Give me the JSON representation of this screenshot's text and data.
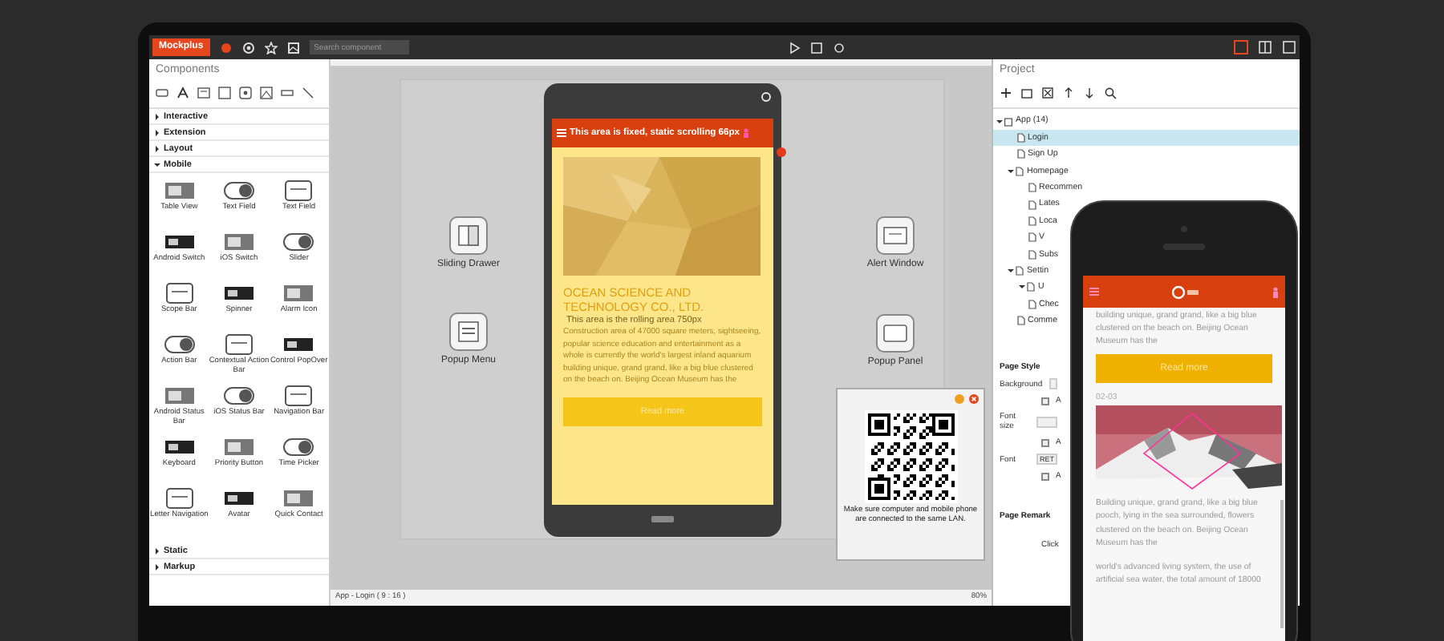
{
  "app": {
    "name": "Mockplus",
    "search": {
      "placeholder": "Search component"
    }
  },
  "components": {
    "title": "Components",
    "categories": [
      {
        "label": "Interactive",
        "expanded": false
      },
      {
        "label": "Extension",
        "expanded": false
      },
      {
        "label": "Layout",
        "expanded": false
      },
      {
        "label": "Mobile",
        "expanded": true
      }
    ],
    "items": [
      "Table View",
      "Text Field",
      "Text Field",
      "Android Switch",
      "iOS Switch",
      "Slider",
      "Scope Bar",
      "Spinner",
      "Alarm Icon",
      "Action Bar",
      "Contextual Action Bar",
      "Control PopOver",
      "Android Status Bar",
      "iOS Status Bar",
      "Navigation Bar",
      "Keyboard",
      "Priority Button",
      "Time Picker",
      "Letter Navigation",
      "Avatar",
      "Quick Contact"
    ],
    "more_categories": [
      {
        "label": "Static",
        "expanded": false
      },
      {
        "label": "Markup",
        "expanded": false
      }
    ]
  },
  "canvas": {
    "left_widgets": [
      "Sliding Drawer",
      "Popup Menu"
    ],
    "right_widgets": [
      "Alert Window",
      "Popup Panel"
    ],
    "device": {
      "header": "This area is fixed, static scrolling 66px",
      "title": "OCEAN SCIENCE AND TECHNOLOGY CO., LTD.",
      "note": "This area is the rolling area 750px",
      "body": "Construction area of 47000 square meters, sightseeing, popular science education and entertainment as a whole is currently the world's largest inland aquarium building unique, grand grand, like a big blue clustered on the beach on. Beijing Ocean Museum has the",
      "button": "Read more"
    },
    "qr_popup": {
      "message": "Make sure computer and mobile phone are connected to the same LAN."
    },
    "status": "App - Login ( 9 : 16 )",
    "zoom": "80%"
  },
  "project": {
    "title": "Project",
    "tree": [
      {
        "label": "App (14)",
        "selected": false,
        "expanded": true,
        "children": [
          {
            "label": "Login",
            "selected": true
          },
          {
            "label": "Sign Up",
            "selected": false
          },
          {
            "label": "Homepage",
            "selected": false,
            "expanded": true,
            "children": [
              {
                "label": "Recommen",
                "selected": false
              },
              {
                "label": "Lates",
                "selected": false
              },
              {
                "label": "Loca",
                "selected": false
              },
              {
                "label": "V",
                "selected": false
              },
              {
                "label": "Subs",
                "selected": false
              }
            ]
          },
          {
            "label": "Settin",
            "selected": false,
            "expanded": true,
            "children": [
              {
                "label": "U",
                "selected": false,
                "expanded": true
              },
              {
                "label": "Chec",
                "selected": false
              }
            ]
          },
          {
            "label": "Comme",
            "selected": false
          }
        ]
      }
    ],
    "page_style": {
      "title": "Page Style",
      "rows": [
        {
          "label": "Background",
          "check": "A",
          "checked": false
        },
        {
          "label": "Font size",
          "check": "A",
          "checked": false
        },
        {
          "label": "Font",
          "value": "RET",
          "check": "A",
          "checked": false
        }
      ]
    },
    "remark": {
      "title": "Page Remark",
      "hint": "Click"
    }
  },
  "phone": {
    "intro": "building unique, grand grand, like a big blue clustered on the beach on. Beijing Ocean Museum has the",
    "button": "Read more",
    "date": "02-03",
    "body": "Building unique, grand grand, like a big blue pooch, lying in the sea surrounded, flowers clustered on the beach on. Beijing Ocean Museum has the",
    "footer": "world's advanced living system, the use of artificial sea water, the total amount of 18000"
  }
}
